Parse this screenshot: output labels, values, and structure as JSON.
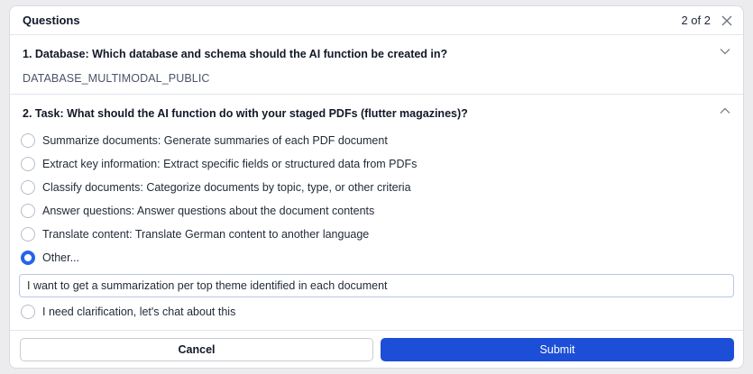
{
  "header": {
    "title": "Questions",
    "pager": "2 of 2",
    "close_icon": "close-icon"
  },
  "question1": {
    "title": "1. Database: Which database and schema should the AI function be created in?",
    "answer": "DATABASE_MULTIMODAL_PUBLIC",
    "icon": "chevron-down-icon"
  },
  "question2": {
    "title": "2. Task: What should the AI function do with your staged PDFs (flutter magazines)?",
    "icon": "chevron-up-icon",
    "options": [
      {
        "label": "Summarize documents: Generate summaries of each PDF document",
        "selected": false
      },
      {
        "label": "Extract key information: Extract specific fields or structured data from PDFs",
        "selected": false
      },
      {
        "label": "Classify documents: Categorize documents by topic, type, or other criteria",
        "selected": false
      },
      {
        "label": "Answer questions: Answer questions about the document contents",
        "selected": false
      },
      {
        "label": "Translate content: Translate German content to another language",
        "selected": false
      },
      {
        "label": "Other...",
        "selected": true
      }
    ],
    "other_value": "I want to get a summarization per top theme identified in each document",
    "clarify_option": {
      "label": "I need clarification, let's chat about this",
      "selected": false
    }
  },
  "footer": {
    "cancel_label": "Cancel",
    "submit_label": "Submit"
  },
  "colors": {
    "accent": "#1d4ed8",
    "radio_selected": "#2563eb"
  }
}
